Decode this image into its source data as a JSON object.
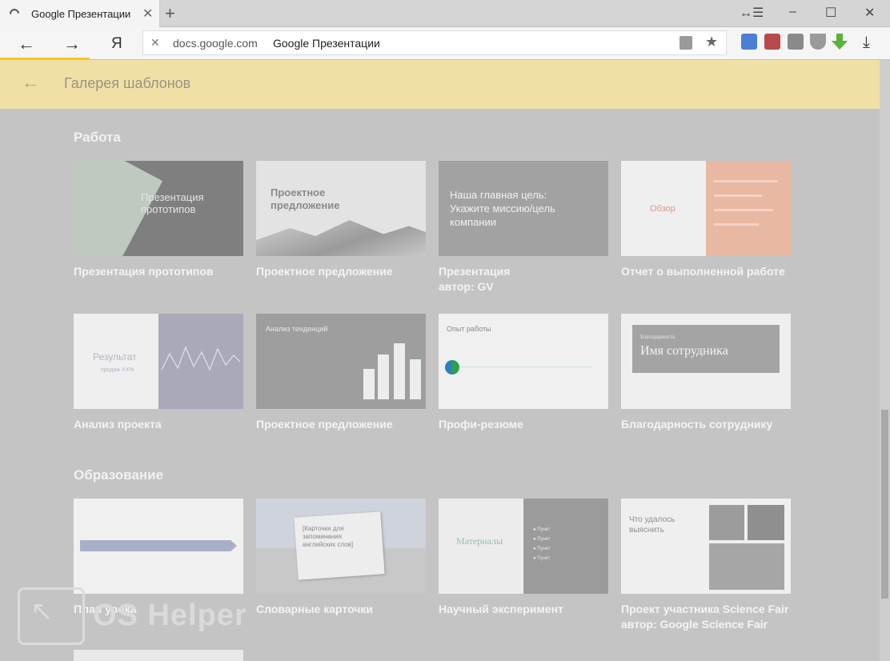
{
  "browser": {
    "tab_title": "Google Презентации",
    "tab_close": "✕",
    "new_tab": "+",
    "url_host": "docs.google.com",
    "url_page_title": "Google Презентации",
    "nav_back": "←",
    "nav_forward": "→",
    "yandex_logo": "Я",
    "omnibox_clear": "✕",
    "star": "★",
    "download": "⤓",
    "window_controls": [
      "↔☰",
      "–",
      "☐",
      "✕"
    ]
  },
  "header": {
    "back": "←",
    "title": "Галерея шаблонов"
  },
  "sections": {
    "work": "Работа",
    "education": "Образование"
  },
  "templates": {
    "prototype": {
      "label": "Презентация прототипов",
      "thumb_text": "Презентация прототипов"
    },
    "proposal": {
      "label": "Проектное предложение",
      "thumb_text": "Проектное предложение"
    },
    "gv": {
      "label": "Презентация",
      "author": "автор: GV",
      "thumb_text": "Наша главная цель: Укажите миссию/цель компании"
    },
    "report": {
      "label": "Отчет о выполненной работе",
      "thumb_text": "Обзор"
    },
    "analysis": {
      "label": "Анализ проекта",
      "thumb_text": "Результат",
      "thumb_sub": "продаж XX%"
    },
    "proposal2": {
      "label": "Проектное предложение",
      "thumb_text": "Анализ тенденций"
    },
    "resume": {
      "label": "Профи-резюме",
      "thumb_text": "Опыт работы"
    },
    "thanks": {
      "label": "Благодарность сотруднику",
      "thumb_small": "Благодарность",
      "thumb_text": "Имя сотрудника"
    },
    "plan": {
      "label": "План урока"
    },
    "cards": {
      "label": "Словарные карточки",
      "thumb_text": "[Карточки для запоминания английских слов]"
    },
    "experiment": {
      "label": "Научный эксперимент",
      "thumb_text": "Материалы",
      "thumb_items": [
        "● Пункт",
        "● Пункт",
        "● Пункт",
        "● Пункт"
      ]
    },
    "fair": {
      "label": "Проект участника Science Fair",
      "author": "автор: Google Science Fair",
      "thumb_text": "Что удалось выяснить"
    }
  },
  "watermark": "OS Helper",
  "colors": {
    "header_bg": "#f0e0a6",
    "loading_bar": "#f7c71a",
    "overlay_bg": "#c4c4c4"
  }
}
